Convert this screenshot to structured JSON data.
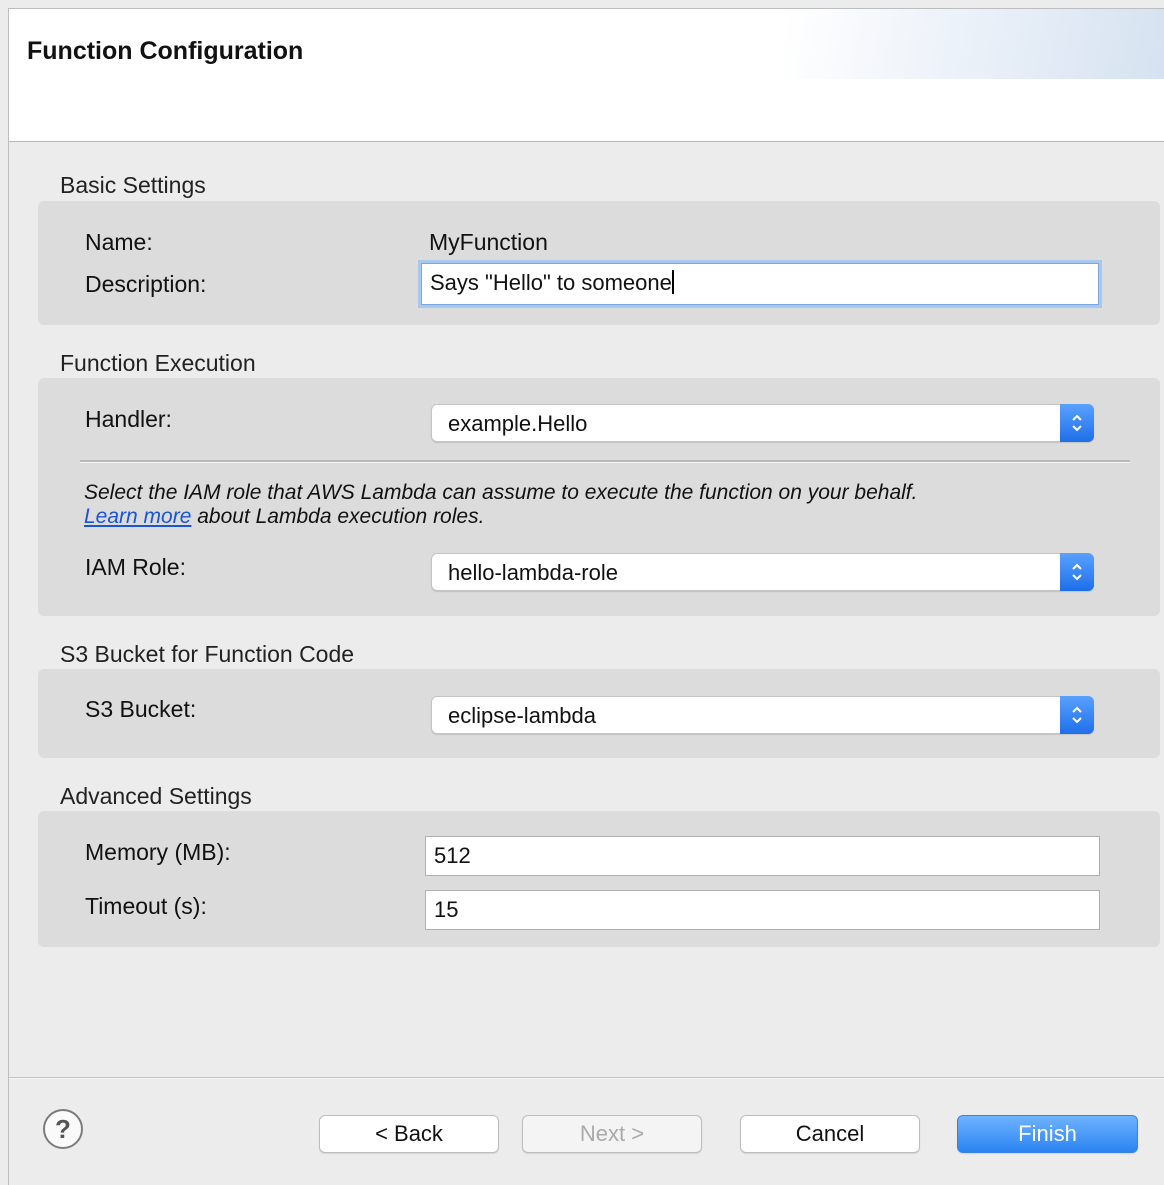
{
  "header": {
    "title": "Function Configuration"
  },
  "basic_settings": {
    "title": "Basic Settings",
    "name_label": "Name:",
    "name_value": "MyFunction",
    "description_label": "Description:",
    "description_value": "Says \"Hello\" to someone"
  },
  "function_execution": {
    "title": "Function Execution",
    "handler_label": "Handler:",
    "handler_value": "example.Hello",
    "iam_help_text": "Select the IAM role that AWS Lambda can assume to execute the function on your behalf.",
    "learn_more_link": "Learn more",
    "learn_more_suffix": " about Lambda execution roles.",
    "iam_role_label": "IAM Role:",
    "iam_role_value": "hello-lambda-role"
  },
  "s3": {
    "title": "S3 Bucket for Function Code",
    "bucket_label": "S3 Bucket:",
    "bucket_value": "eclipse-lambda"
  },
  "advanced_settings": {
    "title": "Advanced Settings",
    "memory_label": "Memory (MB):",
    "memory_value": "512",
    "timeout_label": "Timeout (s):",
    "timeout_value": "15"
  },
  "footer": {
    "help_glyph": "?",
    "back_label": "< Back",
    "next_label": "Next >",
    "cancel_label": "Cancel",
    "finish_label": "Finish"
  },
  "colors": {
    "accent": "#2b84f2",
    "link": "#1a55d6",
    "group_bg": "#dcdcdc"
  }
}
